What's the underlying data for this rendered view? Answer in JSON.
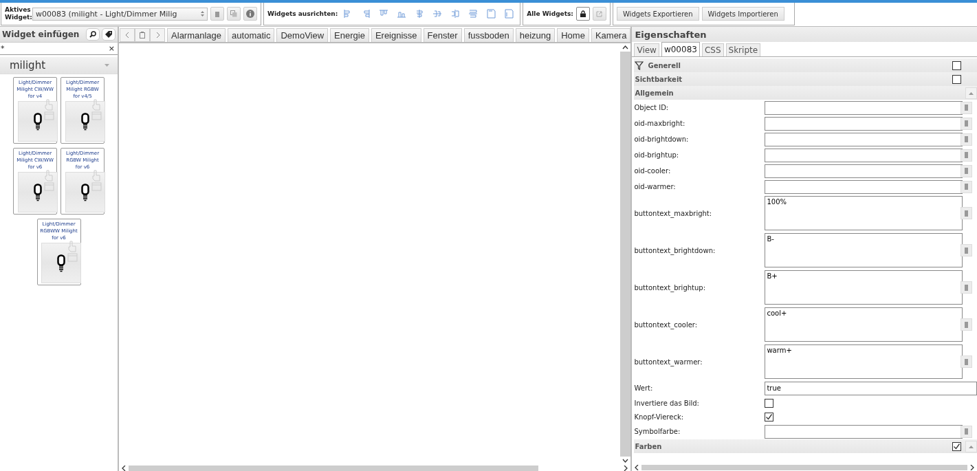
{
  "toolbar": {
    "active_widget_label": "Aktives Widget:",
    "active_widget_value": "w00083 (milight - Light/Dimmer Milig",
    "align_label": "Widgets ausrichten:",
    "all_widgets_label": "Alle Widgets:",
    "buttons": [
      "Widgets Exportieren",
      "Widgets Importieren"
    ]
  },
  "palette": {
    "title": "Widget einfügen",
    "filter": "*",
    "clear": "×",
    "group": "milight",
    "widgets": [
      {
        "title": "Light/Dimmer Milight CW/WW for v4"
      },
      {
        "title": "Light/Dimmer Milight RGBW for v4/5"
      },
      {
        "title": "Light/Dimmer Milight CW/WW for v6"
      },
      {
        "title": "Light/Dimmer RGBW Milight for v6"
      },
      {
        "title": "Light/Dimmer RGBWW Milight for v6"
      }
    ]
  },
  "views": {
    "tabs": [
      {
        "label": "Alarmanlage"
      },
      {
        "label": "automatic"
      },
      {
        "label": "DemoView"
      },
      {
        "label": "Energie"
      },
      {
        "label": "Ereignisse"
      },
      {
        "label": "Fenster"
      },
      {
        "label": "fussboden"
      },
      {
        "label": "heizung"
      },
      {
        "label": "Home"
      },
      {
        "label": "Kamera"
      }
    ]
  },
  "properties": {
    "title": "Eigenschaften",
    "tabs": [
      {
        "label": "View",
        "selected": false
      },
      {
        "label": "w00083",
        "selected": true
      },
      {
        "label": "CSS",
        "selected": false
      },
      {
        "label": "Skripte",
        "selected": false
      }
    ],
    "rows": [
      {
        "kind": "header",
        "label": "Generell",
        "filter": true,
        "checked": false,
        "collapsible": false
      },
      {
        "kind": "header",
        "label": "Sichtbarkeit",
        "checked": false,
        "collapsible": false
      },
      {
        "kind": "header",
        "label": "Allgemein",
        "collapsible": true
      },
      {
        "kind": "text",
        "label": "Object ID:"
      },
      {
        "kind": "text",
        "label": "oid-maxbright:"
      },
      {
        "kind": "text",
        "label": "oid-brightdown:"
      },
      {
        "kind": "text",
        "label": "oid-brightup:"
      },
      {
        "kind": "text",
        "label": "oid-cooler:"
      },
      {
        "kind": "text",
        "label": "oid-warmer:"
      },
      {
        "kind": "textarea",
        "label": "buttontext_maxbright:",
        "value": "100%"
      },
      {
        "kind": "textarea",
        "label": "buttontext_brightdown:",
        "value": "B-"
      },
      {
        "kind": "textarea",
        "label": "buttontext_brightup:",
        "value": "B+"
      },
      {
        "kind": "textarea",
        "label": "buttontext_cooler:",
        "value": "cool+"
      },
      {
        "kind": "textarea",
        "label": "buttontext_warmer:",
        "value": "warm+"
      },
      {
        "kind": "value",
        "label": "Wert:",
        "value": "true"
      },
      {
        "kind": "checkbox",
        "label": "Invertiere das Bild:",
        "checked": false
      },
      {
        "kind": "checkbox",
        "label": "Knopf-Viereck:",
        "checked": true
      },
      {
        "kind": "text",
        "label": "Symbolfarbe:"
      },
      {
        "kind": "header",
        "label": "Farben",
        "checked": true,
        "collapsible": true
      }
    ]
  }
}
